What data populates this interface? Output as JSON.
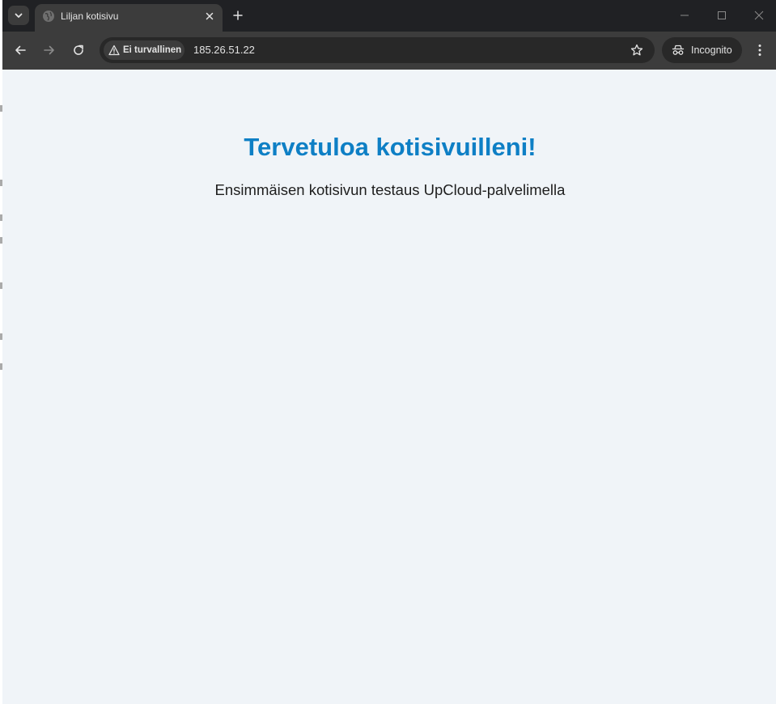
{
  "tab": {
    "title": "Liljan kotisivu",
    "favicon": "globe-icon",
    "close": "close-icon"
  },
  "toolbar": {
    "security_label": "Ei turvallinen",
    "url": "185.26.51.22",
    "incognito_label": "Incognito"
  },
  "page": {
    "heading": "Tervetuloa kotisivuilleni!",
    "subtitle": "Ensimmäisen kotisivun testaus UpCloud-palvelimella"
  },
  "colors": {
    "page_background": "#f0f4f8",
    "heading": "#0e7fc5",
    "browser_frame": "#202124",
    "toolbar": "#3c3c3c"
  }
}
